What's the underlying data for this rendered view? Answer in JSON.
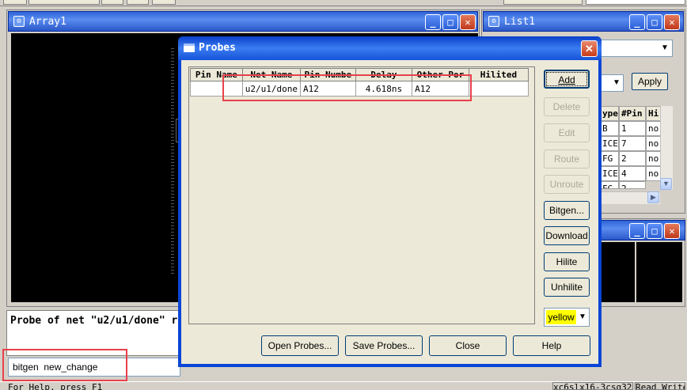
{
  "array_window": {
    "title": "Array1"
  },
  "list_window": {
    "title": "List1",
    "apply_label": "Apply",
    "headers": [
      "ype",
      "#Pin",
      "Hi"
    ],
    "rows": [
      [
        "B",
        "1",
        "no"
      ],
      [
        "ICE",
        "7",
        "no"
      ],
      [
        "FG",
        "2",
        "no"
      ],
      [
        "ICE",
        "4",
        "no"
      ],
      [
        "FG",
        "2",
        ""
      ]
    ]
  },
  "probes_dialog": {
    "title": "Probes",
    "columns": [
      "Pin Name",
      "Net Name",
      "Pin Numbe",
      "Delay",
      "Other Por",
      "Hilited"
    ],
    "row": {
      "pin_name": "",
      "net_name": "u2/u1/done",
      "pin_number": "A12",
      "delay": "4.618ns",
      "other_port": "A12",
      "hilited": ""
    },
    "buttons": {
      "add": "Add",
      "delete": "Delete",
      "edit": "Edit",
      "route": "Route",
      "unroute": "Unroute",
      "bitgen": "Bitgen...",
      "download": "Download",
      "hilite": "Hilite",
      "unhilite": "Unhilite"
    },
    "color_select": "yellow",
    "bottom_buttons": {
      "open": "Open Probes...",
      "save": "Save Probes...",
      "close": "Close",
      "help": "Help"
    }
  },
  "console": {
    "message": "Probe of net \"u2/u1/done\" r",
    "command": "bitgen  new_change"
  },
  "statusbar": {
    "left": "For Help, press F1",
    "device": "xc6slx16-3csg324",
    "mode": "Read Write"
  },
  "colors": {
    "title_blue": "#2f64d8",
    "highlight_red": "#e8414a",
    "select_yellow": "#ffff00"
  }
}
